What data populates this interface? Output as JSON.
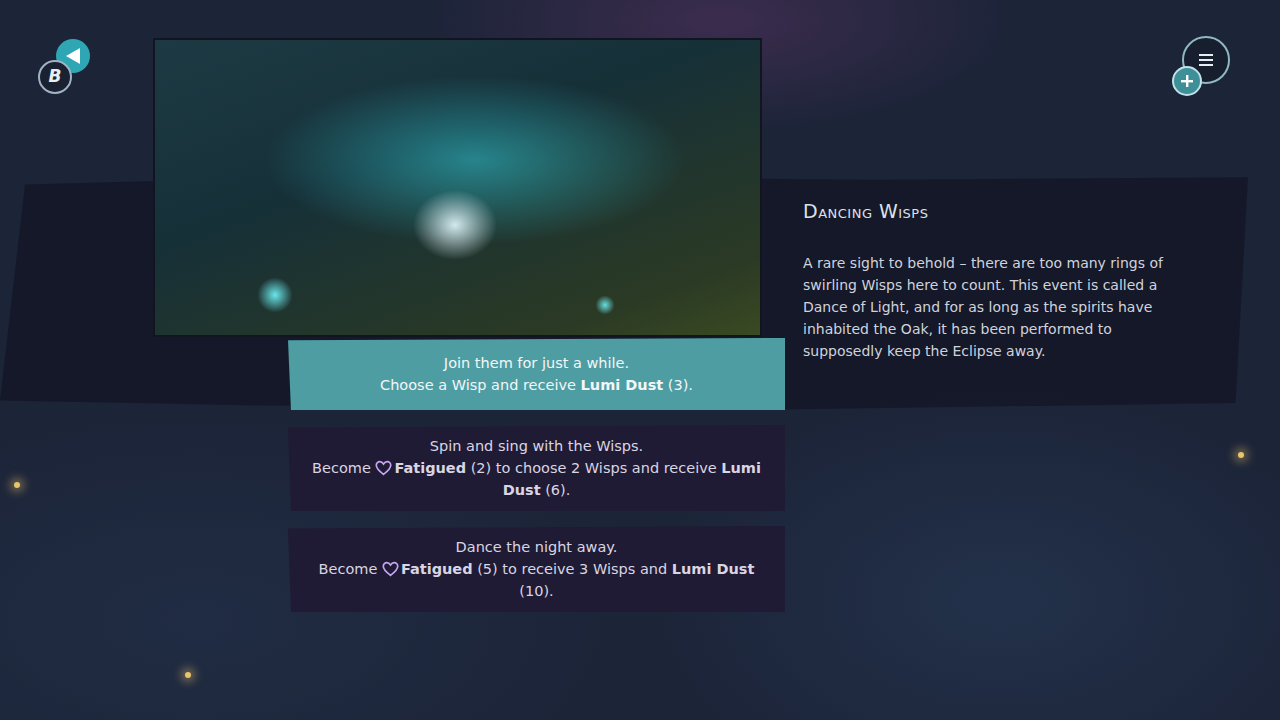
{
  "back_button": {
    "key": "B"
  },
  "event": {
    "title": "Dancing Wisps",
    "description": "A rare sight to behold – there are too many rings of swirling Wisps here to count. This event is called a Dance of Light, and for as long as the spirits have inhabited the Oak, it has been performed to supposedly keep the Eclipse away."
  },
  "options": [
    {
      "title": "Join them for just a while.",
      "selected": true,
      "effect": [
        {
          "kind": "plain",
          "text": "Choose a Wisp and receive "
        },
        {
          "kind": "bold",
          "text": "Lumi Dust"
        },
        {
          "kind": "plain",
          "text": " (3)."
        }
      ]
    },
    {
      "title": "Spin and sing with the Wisps.",
      "selected": false,
      "effect": [
        {
          "kind": "plain",
          "text": "Become "
        },
        {
          "kind": "status",
          "text": "Fatigued"
        },
        {
          "kind": "plain",
          "text": " (2) to choose 2 Wisps and receive "
        },
        {
          "kind": "bold",
          "text": "Lumi Dust"
        },
        {
          "kind": "plain",
          "text": " (6)."
        }
      ]
    },
    {
      "title": "Dance the night away.",
      "selected": false,
      "effect": [
        {
          "kind": "plain",
          "text": "Become "
        },
        {
          "kind": "status",
          "text": "Fatigued"
        },
        {
          "kind": "plain",
          "text": " (5) to receive 3 Wisps and "
        },
        {
          "kind": "bold",
          "text": "Lumi Dust"
        },
        {
          "kind": "plain",
          "text": " (10)."
        }
      ]
    }
  ]
}
